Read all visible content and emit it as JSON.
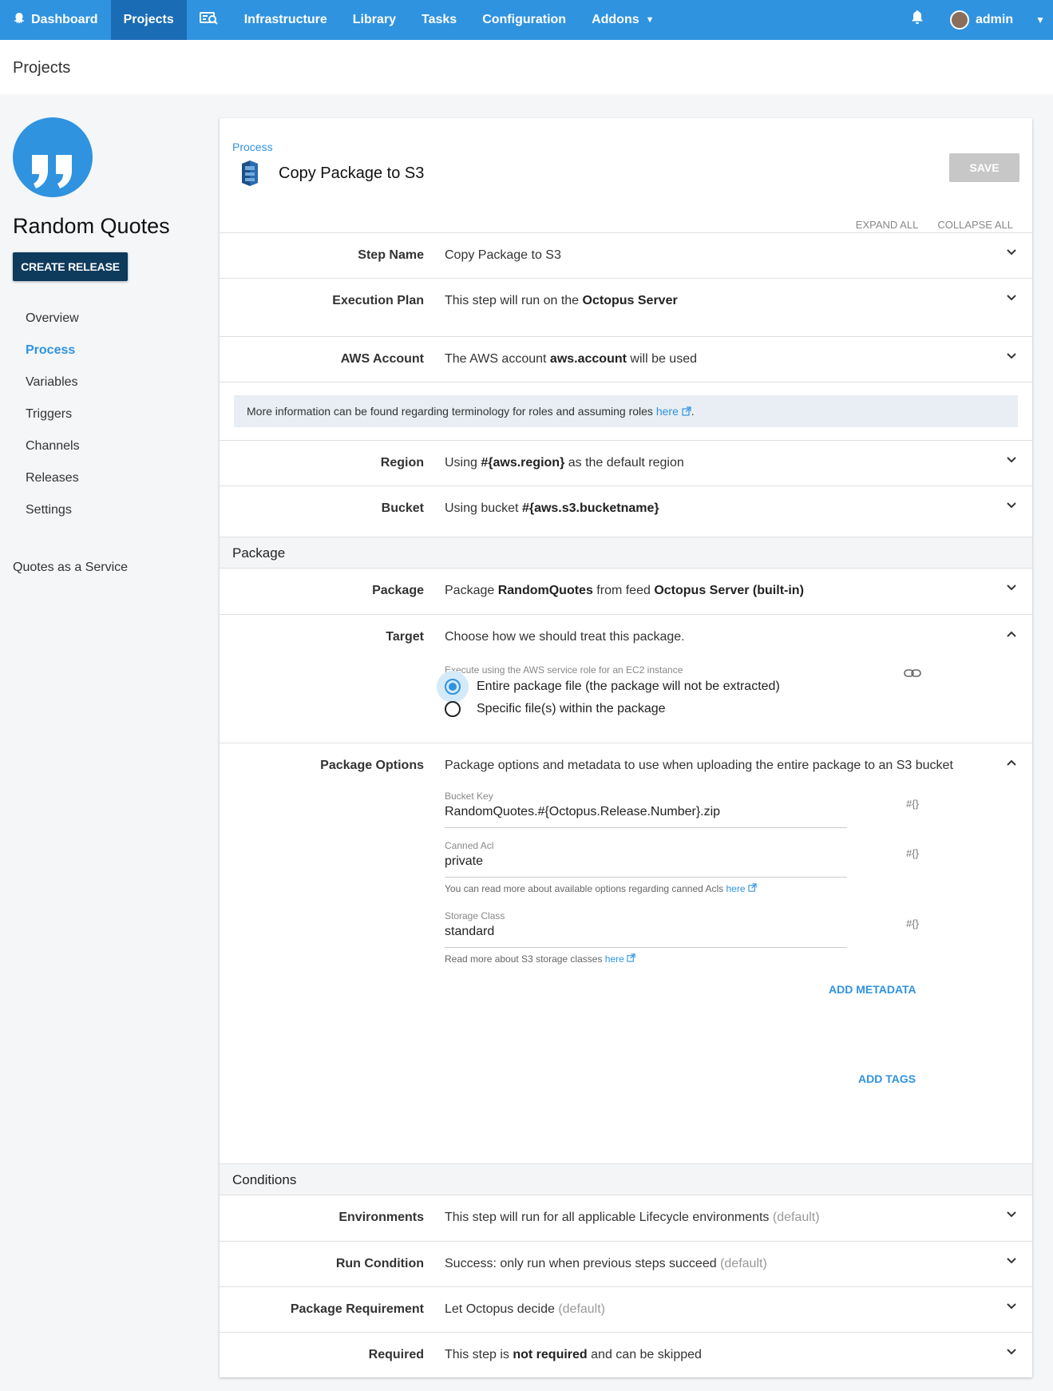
{
  "nav": {
    "items": [
      {
        "label": "Dashboard",
        "icon": "octopus-icon",
        "active": false
      },
      {
        "label": "Projects",
        "active": true
      },
      {
        "label": "",
        "icon": "search-screen-icon",
        "active": false
      },
      {
        "label": "Infrastructure",
        "active": false
      },
      {
        "label": "Library",
        "active": false
      },
      {
        "label": "Tasks",
        "active": false
      },
      {
        "label": "Configuration",
        "active": false
      },
      {
        "label": "Addons",
        "active": false
      }
    ],
    "user": "admin"
  },
  "page": {
    "title": "Projects"
  },
  "sidebar": {
    "project_name": "Random Quotes",
    "create_release": "CREATE RELEASE",
    "menu": [
      "Overview",
      "Process",
      "Variables",
      "Triggers",
      "Channels",
      "Releases",
      "Settings"
    ],
    "active_menu": "Process",
    "footer": "Quotes as a Service"
  },
  "card": {
    "breadcrumb": "Process",
    "title": "Copy Package to S3",
    "save": "SAVE",
    "expand_all": "EXPAND ALL",
    "collapse_all": "COLLAPSE ALL",
    "rows": {
      "step_name": {
        "label": "Step Name",
        "value": "Copy Package to S3"
      },
      "execution_plan": {
        "label": "Execution Plan",
        "prefix": "This step will run on the ",
        "bold": "Octopus Server"
      },
      "aws_account": {
        "label": "AWS Account",
        "prefix": "The AWS account ",
        "bold": "aws.account",
        "suffix": " will be used"
      },
      "info": {
        "text": "More information can be found regarding terminology for roles and assuming roles ",
        "link": "here",
        "suffix": "."
      },
      "region": {
        "label": "Region",
        "prefix": "Using ",
        "bold": "#{aws.region}",
        "suffix": " as the default region"
      },
      "bucket": {
        "label": "Bucket",
        "prefix": "Using bucket ",
        "bold": "#{aws.s3.bucketname}"
      },
      "package_section": "Package",
      "package": {
        "label": "Package",
        "prefix": "Package ",
        "bold1": "RandomQuotes",
        "mid": " from feed ",
        "bold2": "Octopus Server (built-in)"
      },
      "target": {
        "label": "Target",
        "value": "Choose how we should treat this package.",
        "sub_label": "Execute using the AWS service role for an EC2 instance",
        "options": [
          "Entire package file (the package will not be extracted)",
          "Specific file(s) within the package"
        ],
        "selected": 0
      },
      "package_options": {
        "label": "Package Options",
        "value": "Package options and metadata to use when uploading the entire package to an S3 bucket",
        "bucket_key_label": "Bucket Key",
        "bucket_key": "RandomQuotes.#{Octopus.Release.Number}.zip",
        "canned_acl_label": "Canned Acl",
        "canned_acl": "private",
        "canned_acl_help": "You can read more about available options regarding canned Acls ",
        "storage_class_label": "Storage Class",
        "storage_class": "standard",
        "storage_class_help": "Read more about S3 storage classes ",
        "help_link": "here",
        "hash": "#{}",
        "add_metadata": "ADD METADATA",
        "add_tags": "ADD TAGS"
      },
      "conditions_section": "Conditions",
      "environments": {
        "label": "Environments",
        "value": "This step will run for all applicable Lifecycle environments ",
        "dim": "(default)"
      },
      "run_condition": {
        "label": "Run Condition",
        "value": "Success: only run when previous steps succeed ",
        "dim": "(default)"
      },
      "package_requirement": {
        "label": "Package Requirement",
        "value": "Let Octopus decide ",
        "dim": "(default)"
      },
      "required": {
        "label": "Required",
        "prefix": "This step is ",
        "bold": "not required",
        "suffix": " and can be skipped"
      }
    }
  },
  "colors": {
    "primary": "#2f93e0",
    "nav_active": "#1a6cb5",
    "dark_button": "#0e3a5c"
  }
}
